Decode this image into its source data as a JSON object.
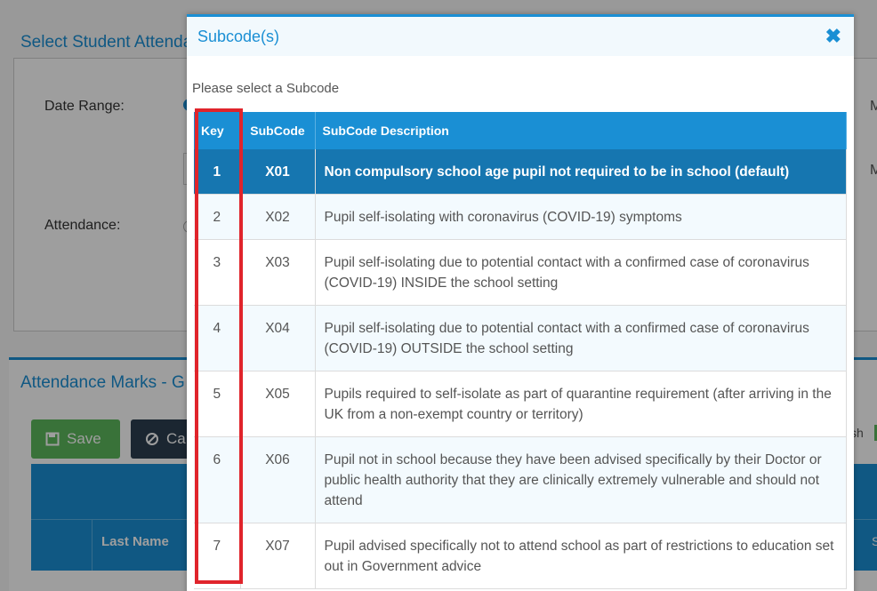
{
  "background": {
    "section1_title": "Select Student Attenda",
    "date_range_label": "Date Range:",
    "attendance_label": "Attendance:",
    "right_letter_1": "M",
    "right_letter_2": "M",
    "section2_title": "Attendance Marks - G",
    "save_label": "Save",
    "cancel_label": "Ca",
    "right_text": "sh",
    "last_name_header": "Last Name",
    "right_edge_char": "S"
  },
  "modal": {
    "title": "Subcode(s)",
    "close_icon": "close-icon",
    "prompt": "Please select a Subcode",
    "columns": [
      "Key",
      "SubCode",
      "SubCode Description"
    ],
    "rows": [
      {
        "key": "1",
        "code": "X01",
        "description": "Non compulsory school age pupil not required to be in school  (default)",
        "selected": true
      },
      {
        "key": "2",
        "code": "X02",
        "description": "Pupil self-isolating with coronavirus (COVID-19) symptoms"
      },
      {
        "key": "3",
        "code": "X03",
        "description": "Pupil self-isolating due to potential contact with a confirmed case of coronavirus (COVID-19) INSIDE the school setting"
      },
      {
        "key": "4",
        "code": "X04",
        "description": "Pupil self-isolating due to potential contact with a confirmed case of coronavirus (COVID-19) OUTSIDE the school setting"
      },
      {
        "key": "5",
        "code": "X05",
        "description": "Pupils required to self-isolate as part of quarantine requirement (after arriving in the UK from a non-exempt country or territory)"
      },
      {
        "key": "6",
        "code": "X06",
        "description": "Pupil not in school because they have been advised specifically by their Doctor or public health authority that they are clinically extremely vulnerable and should not attend"
      },
      {
        "key": "7",
        "code": "X07",
        "description": "Pupil advised specifically not to attend school as part of restrictions to education set out in Government advice"
      }
    ]
  },
  "colors": {
    "accent": "#1a8fd4",
    "selected_row": "#1676b0",
    "highlight": "#e0242b",
    "save_green": "#5cb85c"
  }
}
